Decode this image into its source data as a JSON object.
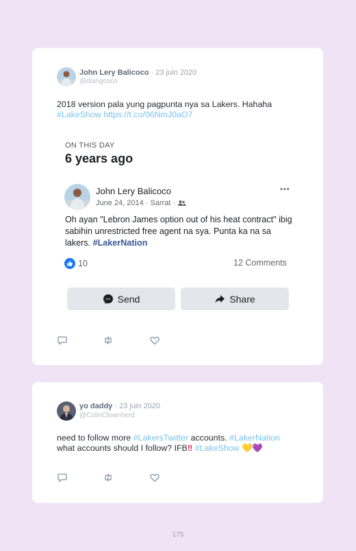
{
  "tweets": [
    {
      "author": "John Lery Balicoco",
      "date": "· 23 juin 2020",
      "handle": "@diangcoco",
      "text_plain": "2018 version pala yung pagpunta nya sa Lakers. Hahaha",
      "hashtag": "#LakeShow",
      "url": "https://t.co/06NmJ0aO7"
    },
    {
      "author": "yo daddy",
      "date": "· 23 juin 2020",
      "handle": "@ColinClownherd",
      "text_a": "need to follow more ",
      "hashtag_a": "#LakersTwitter",
      "text_b": " accounts. ",
      "hashtag_b": "#LakerNation",
      "text_c": "what accounts should I follow? IFB",
      "emoji_1": "‼",
      "hashtag_c": "#LakeShow",
      "emoji_2": "💛💜"
    }
  ],
  "facebook_embed": {
    "on_this_day": "ON THIS DAY",
    "years_ago": "6 years ago",
    "author": "John Lery Balicoco",
    "meta": "June 24, 2014 · Sarrat ·",
    "text": "Oh ayan \"Lebron James option out of his heat contract\" ibig sabihin unrestricted free agent na sya. Punta ka na sa lakers. ",
    "hashtag": "#LakerNation",
    "likes": "10",
    "comments": "12 Comments",
    "send_label": "Send",
    "share_label": "Share",
    "more": "•••"
  },
  "icons": {
    "reply": "reply-icon",
    "retweet": "retweet-icon",
    "like": "like-icon",
    "messenger": "messenger-icon",
    "share": "share-icon",
    "friends": "friends-icon",
    "thumbs_up": "thumbs-up-icon"
  },
  "colors": {
    "background": "#f0e3f6",
    "link": "#79c2ec",
    "fb_button": "#e4e6eb",
    "fb_blue": "#1877f2"
  },
  "page_number": "175"
}
